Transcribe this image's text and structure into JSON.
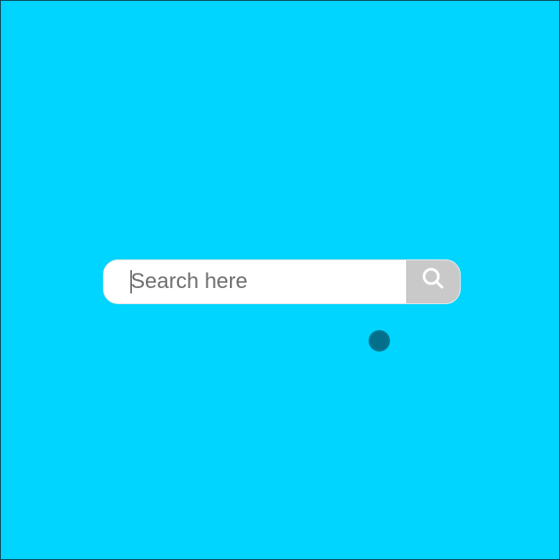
{
  "colors": {
    "background": "#00d5ff",
    "search_button": "#c9c9c9",
    "cursor": "#036f8a",
    "icon": "#ffffff"
  },
  "search": {
    "placeholder": "Search here",
    "value": "",
    "button_icon": "search-icon"
  },
  "cursor_indicator": {
    "shape": "circle"
  }
}
